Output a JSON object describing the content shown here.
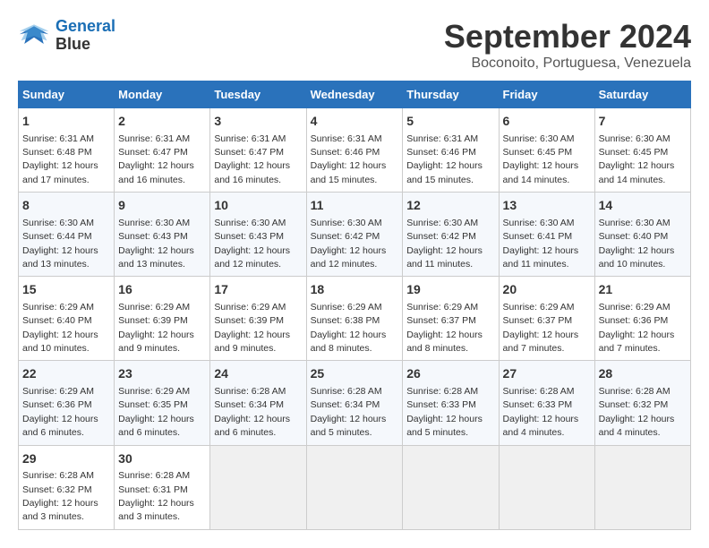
{
  "logo": {
    "line1": "General",
    "line2": "Blue"
  },
  "title": "September 2024",
  "location": "Boconoito, Portuguesa, Venezuela",
  "days_of_week": [
    "Sunday",
    "Monday",
    "Tuesday",
    "Wednesday",
    "Thursday",
    "Friday",
    "Saturday"
  ],
  "weeks": [
    [
      {
        "day": "1",
        "sunrise": "6:31 AM",
        "sunset": "6:48 PM",
        "daylight": "12 hours and 17 minutes."
      },
      {
        "day": "2",
        "sunrise": "6:31 AM",
        "sunset": "6:47 PM",
        "daylight": "12 hours and 16 minutes."
      },
      {
        "day": "3",
        "sunrise": "6:31 AM",
        "sunset": "6:47 PM",
        "daylight": "12 hours and 16 minutes."
      },
      {
        "day": "4",
        "sunrise": "6:31 AM",
        "sunset": "6:46 PM",
        "daylight": "12 hours and 15 minutes."
      },
      {
        "day": "5",
        "sunrise": "6:31 AM",
        "sunset": "6:46 PM",
        "daylight": "12 hours and 15 minutes."
      },
      {
        "day": "6",
        "sunrise": "6:30 AM",
        "sunset": "6:45 PM",
        "daylight": "12 hours and 14 minutes."
      },
      {
        "day": "7",
        "sunrise": "6:30 AM",
        "sunset": "6:45 PM",
        "daylight": "12 hours and 14 minutes."
      }
    ],
    [
      {
        "day": "8",
        "sunrise": "6:30 AM",
        "sunset": "6:44 PM",
        "daylight": "12 hours and 13 minutes."
      },
      {
        "day": "9",
        "sunrise": "6:30 AM",
        "sunset": "6:43 PM",
        "daylight": "12 hours and 13 minutes."
      },
      {
        "day": "10",
        "sunrise": "6:30 AM",
        "sunset": "6:43 PM",
        "daylight": "12 hours and 12 minutes."
      },
      {
        "day": "11",
        "sunrise": "6:30 AM",
        "sunset": "6:42 PM",
        "daylight": "12 hours and 12 minutes."
      },
      {
        "day": "12",
        "sunrise": "6:30 AM",
        "sunset": "6:42 PM",
        "daylight": "12 hours and 11 minutes."
      },
      {
        "day": "13",
        "sunrise": "6:30 AM",
        "sunset": "6:41 PM",
        "daylight": "12 hours and 11 minutes."
      },
      {
        "day": "14",
        "sunrise": "6:30 AM",
        "sunset": "6:40 PM",
        "daylight": "12 hours and 10 minutes."
      }
    ],
    [
      {
        "day": "15",
        "sunrise": "6:29 AM",
        "sunset": "6:40 PM",
        "daylight": "12 hours and 10 minutes."
      },
      {
        "day": "16",
        "sunrise": "6:29 AM",
        "sunset": "6:39 PM",
        "daylight": "12 hours and 9 minutes."
      },
      {
        "day": "17",
        "sunrise": "6:29 AM",
        "sunset": "6:39 PM",
        "daylight": "12 hours and 9 minutes."
      },
      {
        "day": "18",
        "sunrise": "6:29 AM",
        "sunset": "6:38 PM",
        "daylight": "12 hours and 8 minutes."
      },
      {
        "day": "19",
        "sunrise": "6:29 AM",
        "sunset": "6:37 PM",
        "daylight": "12 hours and 8 minutes."
      },
      {
        "day": "20",
        "sunrise": "6:29 AM",
        "sunset": "6:37 PM",
        "daylight": "12 hours and 7 minutes."
      },
      {
        "day": "21",
        "sunrise": "6:29 AM",
        "sunset": "6:36 PM",
        "daylight": "12 hours and 7 minutes."
      }
    ],
    [
      {
        "day": "22",
        "sunrise": "6:29 AM",
        "sunset": "6:36 PM",
        "daylight": "12 hours and 6 minutes."
      },
      {
        "day": "23",
        "sunrise": "6:29 AM",
        "sunset": "6:35 PM",
        "daylight": "12 hours and 6 minutes."
      },
      {
        "day": "24",
        "sunrise": "6:28 AM",
        "sunset": "6:34 PM",
        "daylight": "12 hours and 6 minutes."
      },
      {
        "day": "25",
        "sunrise": "6:28 AM",
        "sunset": "6:34 PM",
        "daylight": "12 hours and 5 minutes."
      },
      {
        "day": "26",
        "sunrise": "6:28 AM",
        "sunset": "6:33 PM",
        "daylight": "12 hours and 5 minutes."
      },
      {
        "day": "27",
        "sunrise": "6:28 AM",
        "sunset": "6:33 PM",
        "daylight": "12 hours and 4 minutes."
      },
      {
        "day": "28",
        "sunrise": "6:28 AM",
        "sunset": "6:32 PM",
        "daylight": "12 hours and 4 minutes."
      }
    ],
    [
      {
        "day": "29",
        "sunrise": "6:28 AM",
        "sunset": "6:32 PM",
        "daylight": "12 hours and 3 minutes."
      },
      {
        "day": "30",
        "sunrise": "6:28 AM",
        "sunset": "6:31 PM",
        "daylight": "12 hours and 3 minutes."
      },
      null,
      null,
      null,
      null,
      null
    ]
  ]
}
